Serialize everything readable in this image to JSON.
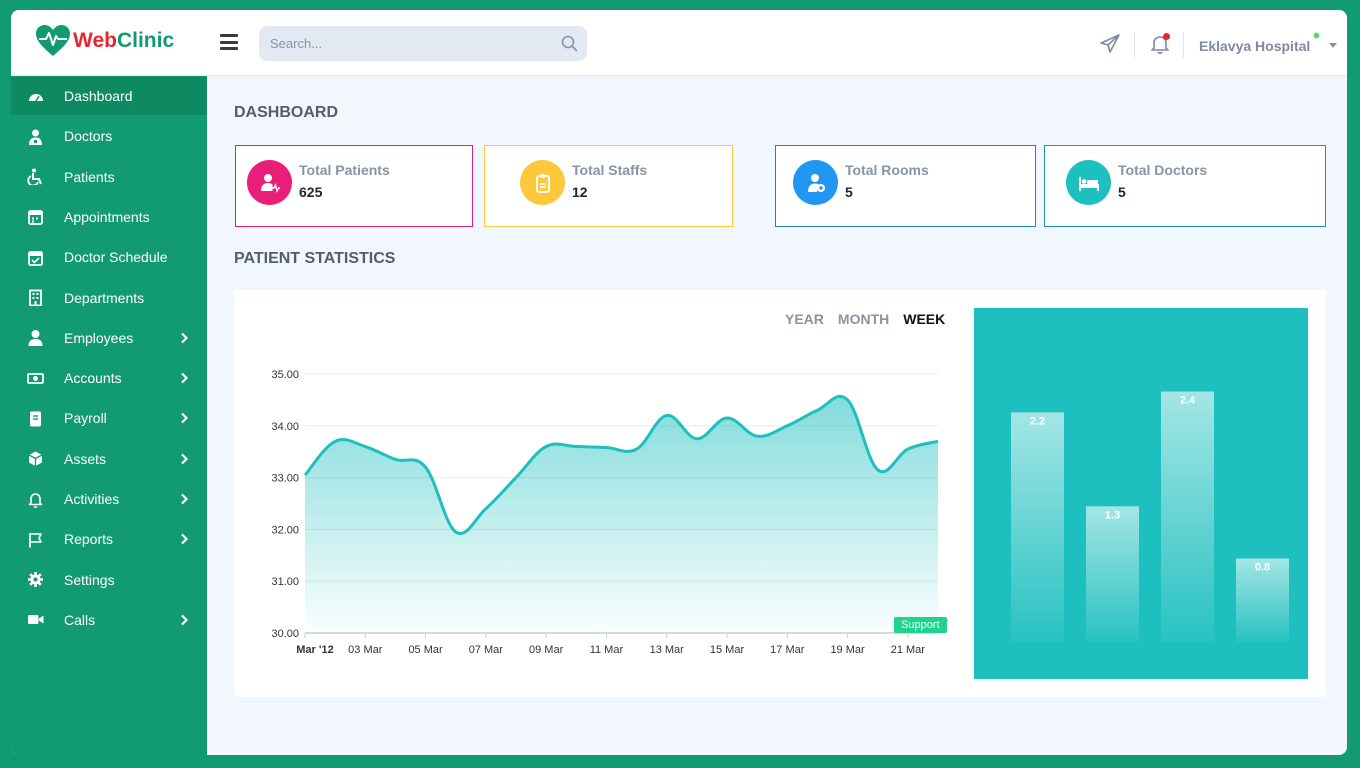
{
  "app": {
    "logo_web": "Web",
    "logo_clinic": "Clinic"
  },
  "header": {
    "search_placeholder": "Search...",
    "user_name": "Eklavya Hospital"
  },
  "sidebar": {
    "items": [
      {
        "label": "Dashboard",
        "icon": "dashboard-icon",
        "active": true,
        "has_submenu": false
      },
      {
        "label": "Doctors",
        "icon": "doctor-icon",
        "active": false,
        "has_submenu": false
      },
      {
        "label": "Patients",
        "icon": "wheelchair-icon",
        "active": false,
        "has_submenu": false
      },
      {
        "label": "Appointments",
        "icon": "calendar-icon",
        "active": false,
        "has_submenu": false
      },
      {
        "label": "Doctor Schedule",
        "icon": "calendar-check-icon",
        "active": false,
        "has_submenu": false
      },
      {
        "label": "Departments",
        "icon": "building-icon",
        "active": false,
        "has_submenu": false
      },
      {
        "label": "Employees",
        "icon": "user-icon",
        "active": false,
        "has_submenu": true
      },
      {
        "label": "Accounts",
        "icon": "money-icon",
        "active": false,
        "has_submenu": true
      },
      {
        "label": "Payroll",
        "icon": "book-icon",
        "active": false,
        "has_submenu": true
      },
      {
        "label": "Assets",
        "icon": "cube-icon",
        "active": false,
        "has_submenu": true
      },
      {
        "label": "Activities",
        "icon": "bell-icon",
        "active": false,
        "has_submenu": true
      },
      {
        "label": "Reports",
        "icon": "flag-icon",
        "active": false,
        "has_submenu": true
      },
      {
        "label": "Settings",
        "icon": "gear-icon",
        "active": false,
        "has_submenu": false
      },
      {
        "label": "Calls",
        "icon": "video-icon",
        "active": false,
        "has_submenu": true
      }
    ]
  },
  "main": {
    "page_title": "DASHBOARD",
    "stats": [
      {
        "label": "Total Patients",
        "value": "625",
        "color": "#e91e78",
        "icon": "patient-icon"
      },
      {
        "label": "Total Staffs",
        "value": "12",
        "color": "#fdc93a",
        "icon": "badge-icon"
      },
      {
        "label": "Total Rooms",
        "value": "5",
        "color": "#2196f3",
        "icon": "user-plus-icon"
      },
      {
        "label": "Total Doctors",
        "value": "5",
        "color": "#1dbfbf",
        "icon": "bed-icon"
      }
    ],
    "section_title": "PATIENT STATISTICS",
    "tabs": [
      {
        "label": "YEAR",
        "active": false
      },
      {
        "label": "MONTH",
        "active": false
      },
      {
        "label": "WEEK",
        "active": true
      }
    ],
    "support_label": "Support"
  },
  "colors": {
    "brand_green": "#129b70",
    "accent_teal": "#1dbfbf",
    "logo_red": "#e8262e"
  },
  "chart_data": [
    {
      "type": "area",
      "x": [
        "Mar '12",
        "",
        "03 Mar",
        "",
        "05 Mar",
        "",
        "07 Mar",
        "",
        "09 Mar",
        "",
        "11 Mar",
        "",
        "13 Mar",
        "",
        "15 Mar",
        "",
        "17 Mar",
        "",
        "19 Mar",
        "",
        "21 Mar",
        ""
      ],
      "x_tick_labels": [
        "Mar '12",
        "03 Mar",
        "05 Mar",
        "07 Mar",
        "09 Mar",
        "11 Mar",
        "13 Mar",
        "15 Mar",
        "17 Mar",
        "19 Mar",
        "21 Mar"
      ],
      "values": [
        33.05,
        33.7,
        33.6,
        33.35,
        33.2,
        31.95,
        32.4,
        33.0,
        33.6,
        33.6,
        33.58,
        33.55,
        34.2,
        33.75,
        34.15,
        33.8,
        34.0,
        34.3,
        34.5,
        33.15,
        33.55,
        33.7
      ],
      "y_ticks": [
        "30.00",
        "31.00",
        "32.00",
        "33.00",
        "34.00",
        "35.00"
      ],
      "ylim": [
        30,
        35
      ],
      "grid": true
    },
    {
      "type": "bar",
      "values": [
        2.2,
        1.3,
        2.4,
        0.8
      ],
      "ylim": [
        0,
        3.2
      ]
    }
  ]
}
